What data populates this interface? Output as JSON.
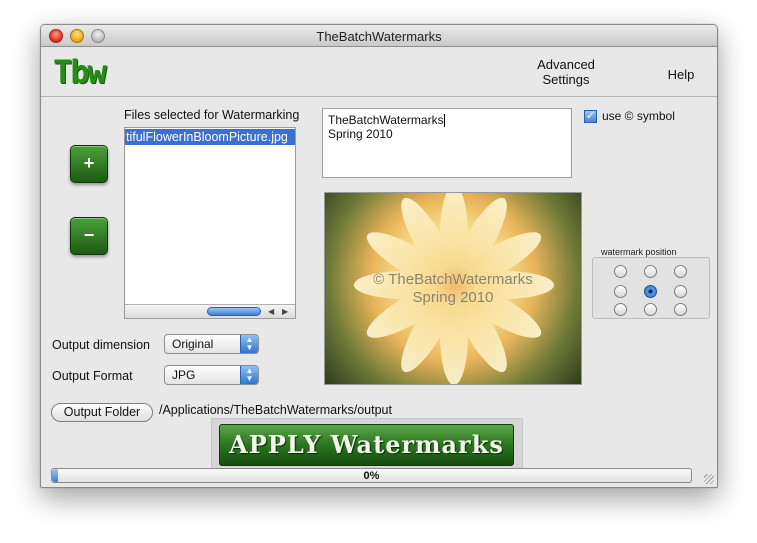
{
  "window": {
    "title": "TheBatchWatermarks"
  },
  "toolbar": {
    "logo": "Tbw",
    "advanced_settings": "Advanced Settings",
    "help": "Help"
  },
  "files": {
    "label": "Files selected for Watermarking",
    "items": [
      "tifulFlowerInBloomPicture.jpg"
    ]
  },
  "buttons": {
    "add": "+",
    "remove": "−"
  },
  "watermark_text": {
    "line1": "TheBatchWatermarks",
    "line2": "Spring 2010"
  },
  "use_symbol": {
    "label": "use © symbol",
    "checked": true
  },
  "preview": {
    "overlay_line1": "© TheBatchWatermarks",
    "overlay_line2": "Spring 2010"
  },
  "watermark_position": {
    "label": "watermark position",
    "selected": "center"
  },
  "output_dimension": {
    "label": "Output dimension",
    "value": "Original"
  },
  "output_format": {
    "label": "Output Format",
    "value": "JPG"
  },
  "output_folder": {
    "button": "Output Folder",
    "path": "/Applications/TheBatchWatermarks/output"
  },
  "apply": {
    "label": "APPLY Watermarks"
  },
  "progress": {
    "value": 0.01,
    "text": "0%"
  },
  "colors": {
    "accent_green": "#2f7a22",
    "selection_blue": "#3b6fd1"
  }
}
